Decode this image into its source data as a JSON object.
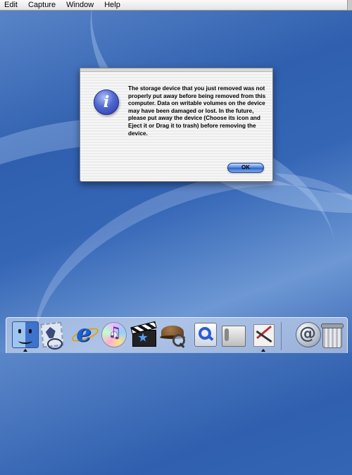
{
  "menubar": {
    "items": [
      "Edit",
      "Capture",
      "Window",
      "Help"
    ]
  },
  "alert": {
    "message": "The storage device that you just removed was not properly put away before being removed from this computer.  Data on writable volumes on the device may have been damaged or lost.  In the future, please put away the device (Choose its icon and Eject it or Drag it to trash) before removing the device.",
    "icon": "info-icon",
    "ok_label": "OK",
    "button_color": "#3f78d8"
  },
  "dock": {
    "apps": [
      "finder",
      "mail-stamp",
      "internet-explorer",
      "itunes",
      "imovie",
      "sherlock",
      "quicktime",
      "system-preferences",
      "grab-utility",
      "mail-at",
      "trash"
    ]
  },
  "colors": {
    "desktop": "#3566b6",
    "menubar": "#eeeeee",
    "dialog": "#efefef"
  }
}
